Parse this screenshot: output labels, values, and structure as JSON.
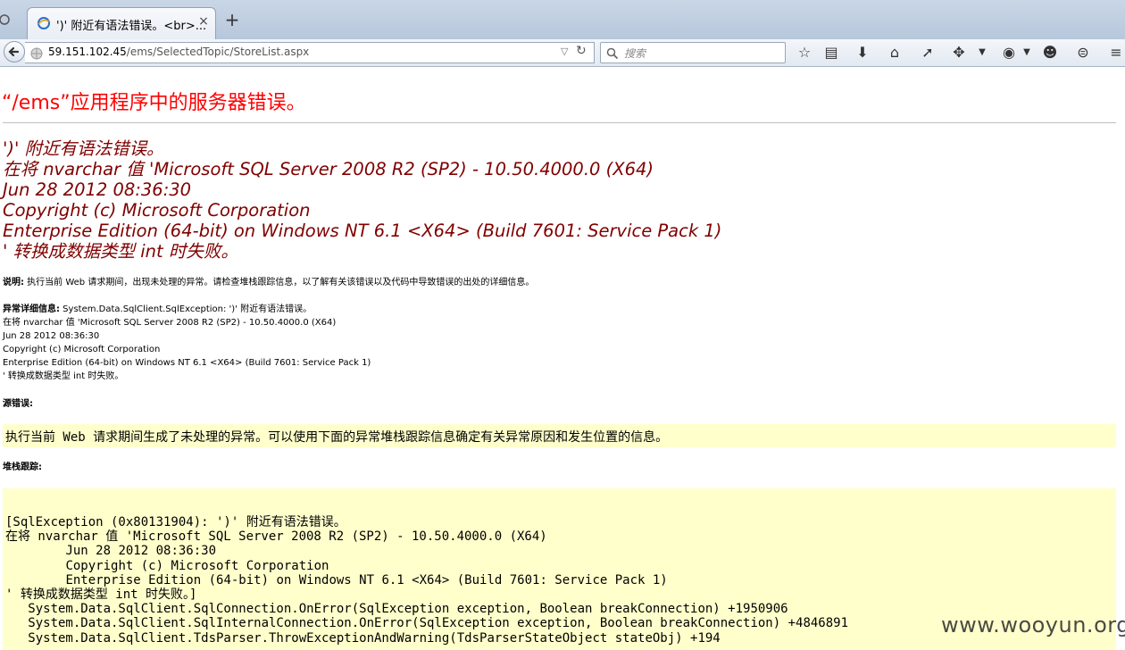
{
  "browser": {
    "tab_title": "')' 附近有语法错误。<br>...",
    "tab_close": "×",
    "new_tab": "+",
    "url_host": "59.151.102.45",
    "url_path": "/ems/SelectedTopic/StoreList.aspx",
    "search_placeholder": "搜索"
  },
  "page": {
    "title": "“/ems”应用程序中的服务器错误。",
    "error_heading": "')' 附近有语法错误。\n在将 nvarchar 值 'Microsoft SQL Server 2008 R2 (SP2) - 10.50.4000.0 (X64)\nJun 28 2012 08:36:30\nCopyright (c) Microsoft Corporation\nEnterprise Edition (64-bit) on Windows NT 6.1 <X64> (Build 7601: Service Pack 1)\n' 转换成数据类型 int 时失败。",
    "description_label": "说明:",
    "description_text": " 执行当前 Web 请求期间，出现未处理的异常。请检查堆栈跟踪信息，以了解有关该错误以及代码中导致错误的出处的详细信息。",
    "exception_label": "异常详细信息:",
    "exception_text": " System.Data.SqlClient.SqlException: ')' 附近有语法错误。\n在将 nvarchar 值 'Microsoft SQL Server 2008 R2 (SP2) - 10.50.4000.0 (X64)\nJun 28 2012 08:36:30\nCopyright (c) Microsoft Corporation\nEnterprise Edition (64-bit) on Windows NT 6.1 <X64> (Build 7601: Service Pack 1)\n' 转换成数据类型 int 时失败。",
    "source_error_label": "源错误:",
    "source_error_text": "执行当前 Web 请求期间生成了未处理的异常。可以使用下面的异常堆栈跟踪信息确定有关异常原因和发生位置的信息。",
    "stack_trace_label": "堆栈跟踪:",
    "stack_trace": "[SqlException (0x80131904): ')' 附近有语法错误。\n在将 nvarchar 值 'Microsoft SQL Server 2008 R2 (SP2) - 10.50.4000.0 (X64)\n\tJun 28 2012 08:36:30\n\tCopyright (c) Microsoft Corporation\n\tEnterprise Edition (64-bit) on Windows NT 6.1 <X64> (Build 7601: Service Pack 1)\n' 转换成数据类型 int 时失败。]\n   System.Data.SqlClient.SqlConnection.OnError(SqlException exception, Boolean breakConnection) +1950906\n   System.Data.SqlClient.SqlInternalConnection.OnError(SqlException exception, Boolean breakConnection) +4846891\n   System.Data.SqlClient.TdsParser.ThrowExceptionAndWarning(TdsParserStateObject stateObj) +194"
  },
  "watermark": "www.wooyun.org",
  "colors": {
    "title_red": "#ff0000",
    "heading_maroon": "#800000",
    "code_bg": "#ffffcc"
  }
}
